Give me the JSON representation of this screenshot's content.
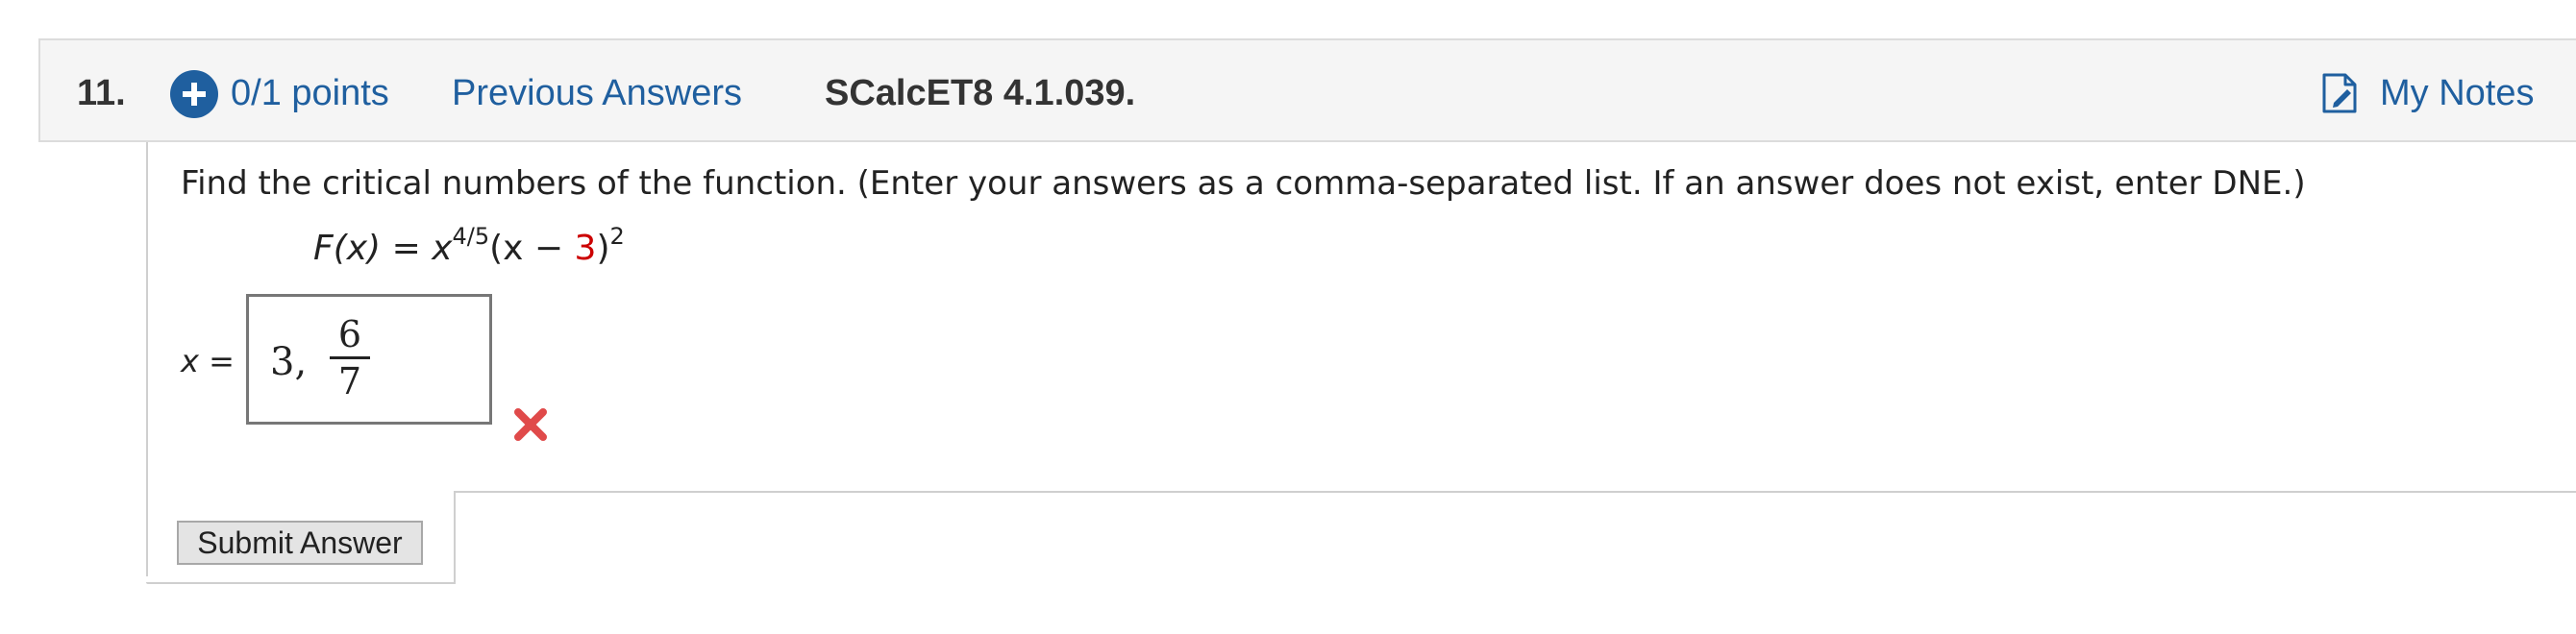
{
  "question": {
    "number": "11.",
    "points": "0/1 points",
    "previous_answers": "Previous Answers",
    "problem_id": "SCalcET8 4.1.039.",
    "my_notes": "My Notes"
  },
  "problem": {
    "instructions": "Find the critical numbers of the function. (Enter your answers as a comma-separated list. If an answer does not exist, enter DNE.)",
    "formula": {
      "lhs": "F(x)",
      "equals": "=",
      "base": "x",
      "exponent": "4/5",
      "open": "(x − ",
      "constant": "3",
      "close": ")",
      "outer_exponent": "2"
    },
    "answer_label_var": "x",
    "answer_label_eq": "=",
    "answer": {
      "integer": "3,",
      "fraction_numerator": "6",
      "fraction_denominator": "7"
    },
    "status": "incorrect"
  },
  "actions": {
    "submit_label": "Submit Answer"
  },
  "colors": {
    "link": "#1f5f9f",
    "incorrect": "#e04a4a",
    "highlight_constant": "#cc0000"
  },
  "icons": [
    "plus-circle-icon",
    "notes-icon",
    "incorrect-x-icon"
  ]
}
